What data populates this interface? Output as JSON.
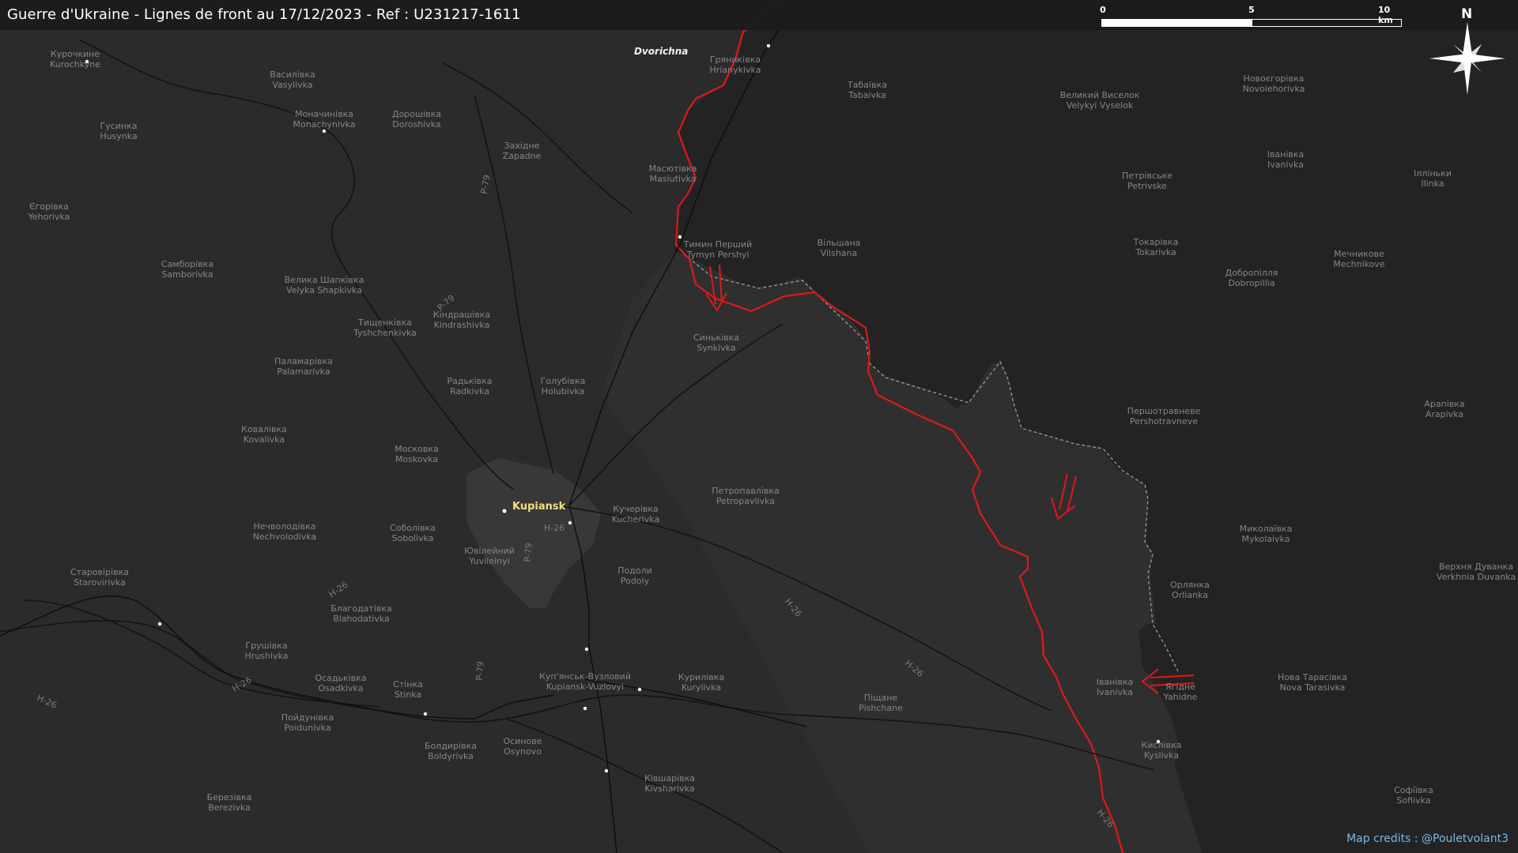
{
  "header": {
    "title": "Guerre d'Ukraine - Lignes de front au 17/12/2023 - Ref : U231217-1611"
  },
  "scale_bar": {
    "labels": [
      "0",
      "5",
      "10 km"
    ]
  },
  "compass": {
    "north_label": "N"
  },
  "credits": "Map credits : @Pouletvolant3",
  "main_city": "Kupiansk",
  "highlight_village": "Dvorichna",
  "colors": {
    "front_line": "#e01818",
    "occupied_area": "#232324",
    "liberated_area": "#2f2f30",
    "city_label": "#f4e07a",
    "credits": "#7ab8e6"
  },
  "places": [
    {
      "uk": "Курочкине",
      "en": "Kurochkyne"
    },
    {
      "uk": "Василівка",
      "en": "Vasylivka"
    },
    {
      "uk": "Гусинка",
      "en": "Husynka"
    },
    {
      "uk": "Моначинівка",
      "en": "Monachynivka"
    },
    {
      "uk": "Дорошівка",
      "en": "Doroshivka"
    },
    {
      "uk": "Західне",
      "en": "Zapadne"
    },
    {
      "uk": "Єгорівка",
      "en": "Yehorivka"
    },
    {
      "uk": "Самборівка",
      "en": "Samborivka"
    },
    {
      "uk": "Велика Шапківка",
      "en": "Velyka Shapkivka"
    },
    {
      "uk": "Кіндрашівка",
      "en": "Kindrashivka"
    },
    {
      "uk": "Тищенківка",
      "en": "Tyshchenkivka"
    },
    {
      "uk": "Паламарівка",
      "en": "Palamarivka"
    },
    {
      "uk": "Радьківка",
      "en": "Radkivka"
    },
    {
      "uk": "Голубівка",
      "en": "Holubivka"
    },
    {
      "uk": "Ковалівка",
      "en": "Kovalivka"
    },
    {
      "uk": "Московка",
      "en": "Moskovka"
    },
    {
      "uk": "Нечволодівка",
      "en": "Nechvolodivka"
    },
    {
      "uk": "Соболівка",
      "en": "Sobolivka"
    },
    {
      "uk": "Ювілейний",
      "en": "Yuvileinyi"
    },
    {
      "uk": "Старовірівка",
      "en": "Starovirivka"
    },
    {
      "uk": "Благодатівка",
      "en": "Blahodativka"
    },
    {
      "uk": "Грушівка",
      "en": "Hrushivka"
    },
    {
      "uk": "Осадьківка",
      "en": "Osadkivka"
    },
    {
      "uk": "Стінка",
      "en": "Stinka"
    },
    {
      "uk": "Пойдунівка",
      "en": "Poidunivka"
    },
    {
      "uk": "Болдирівка",
      "en": "Boldyrivka"
    },
    {
      "uk": "Осинове",
      "en": "Osynovo"
    },
    {
      "uk": "Березівка",
      "en": "Berezivka"
    },
    {
      "uk": "Ківшарівка",
      "en": "Kivsharivka"
    },
    {
      "uk": "Куп'янськ-Вузловий",
      "en": "Kupiansk-Vuzlovyi"
    },
    {
      "uk": "Курилівка",
      "en": "Kurylivka"
    },
    {
      "uk": "Подоли",
      "en": "Podoly"
    },
    {
      "uk": "Кучерівка",
      "en": "Kucherivka"
    },
    {
      "uk": "Петропавлівка",
      "en": "Petropavlivka"
    },
    {
      "uk": "Синьківка",
      "en": "Synkivka"
    },
    {
      "uk": "Масютівка",
      "en": "Masiutivka"
    },
    {
      "uk": "Тимин Перший",
      "en": "Tymyn Pershyi"
    },
    {
      "uk": "Гряниківка",
      "en": "Hrianykivka"
    },
    {
      "uk": "Табаївка",
      "en": "Tabaivka"
    },
    {
      "uk": "Вільшана",
      "en": "Vilshana"
    },
    {
      "uk": "Великий Виселок",
      "en": "Velykyi Vyselok"
    },
    {
      "uk": "Новоєгорівка",
      "en": "Novoiehorivka"
    },
    {
      "uk": "Іванівка",
      "en": "Ivanivka"
    },
    {
      "uk": "Петрівське",
      "en": "Petrivske"
    },
    {
      "uk": "Ілліньки",
      "en": "Ilinka"
    },
    {
      "uk": "Токарівка",
      "en": "Tokarivka"
    },
    {
      "uk": "Добропілля",
      "en": "Dobropillia"
    },
    {
      "uk": "Мечникове",
      "en": "Mechnikove"
    },
    {
      "uk": "Першотравневе",
      "en": "Pershotravneve"
    },
    {
      "uk": "Арапівка",
      "en": "Arapivka"
    },
    {
      "uk": "Миколаївка",
      "en": "Mykolaivka"
    },
    {
      "uk": "Орлянка",
      "en": "Orlianka"
    },
    {
      "uk": "Верхня Дуванка",
      "en": "Verkhnia Duvanka"
    },
    {
      "uk": "Іванівка",
      "en": "Ivanivka"
    },
    {
      "uk": "Ягідне",
      "en": "Yahidne"
    },
    {
      "uk": "Нова Тарасівка",
      "en": "Nova Tarasivka"
    },
    {
      "uk": "Піщане",
      "en": "Pishchane"
    },
    {
      "uk": "Кислівка",
      "en": "Kyslivka"
    },
    {
      "uk": "Софіївка",
      "en": "Sofiivka"
    }
  ],
  "roads": [
    "P-79",
    "P-79",
    "P-79",
    "H-26",
    "H-26",
    "H-26",
    "H-26",
    "H-26",
    "H-26",
    "P-79",
    "H-26"
  ]
}
